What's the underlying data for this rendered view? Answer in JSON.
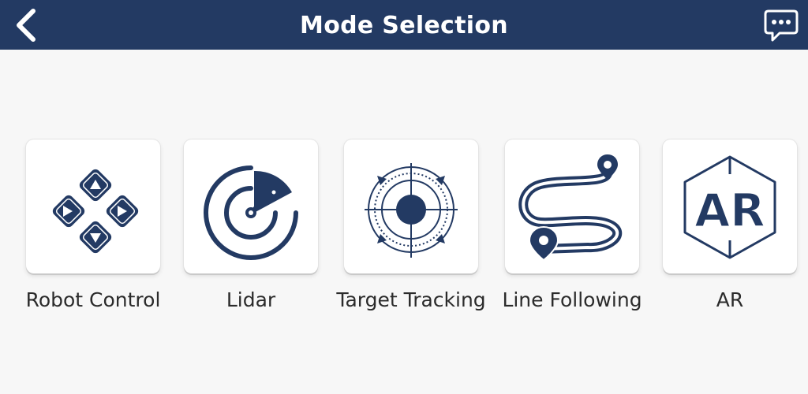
{
  "header": {
    "title": "Mode Selection",
    "back_icon": "chevron-left-icon",
    "chat_icon": "chat-bubble-icon"
  },
  "modes": [
    {
      "label": "Robot Control",
      "icon": "dpad-icon"
    },
    {
      "label": "Lidar",
      "icon": "radar-icon"
    },
    {
      "label": "Target Tracking",
      "icon": "crosshair-icon"
    },
    {
      "label": "Line Following",
      "icon": "route-icon"
    },
    {
      "label": "AR",
      "icon": "ar-hexagon-icon"
    }
  ],
  "colors": {
    "header_bg": "#233a63",
    "accent": "#233a63",
    "background": "#f7f7f7",
    "card_bg": "#ffffff",
    "label_text": "#2b2b2b"
  }
}
